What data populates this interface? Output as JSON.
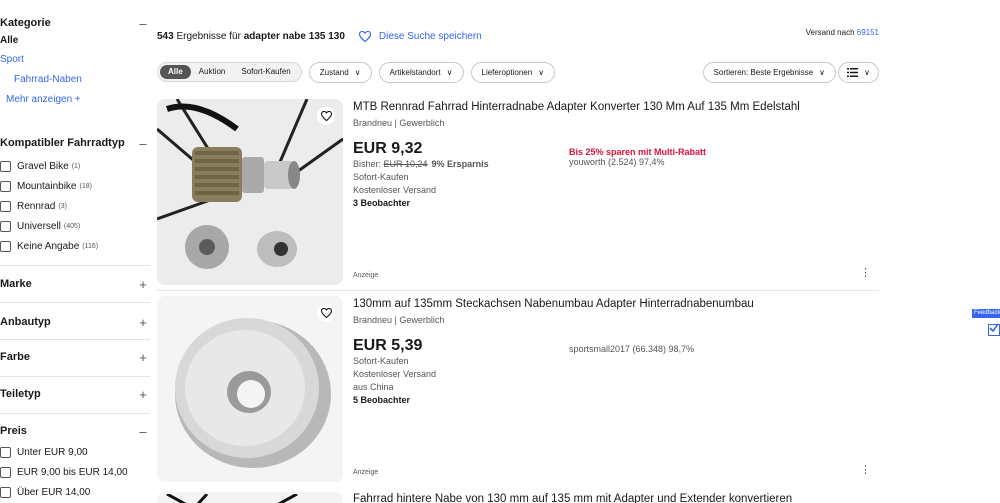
{
  "sidebar": {
    "kategorie": {
      "heading": "Kategorie",
      "toggle": "–",
      "alle": "Alle",
      "sport": "Sport",
      "fahrrad_naben": "Fahrrad-Naben",
      "mehr": "Mehr anzeigen +"
    },
    "fahrradtyp": {
      "heading": "Kompatibler Fahrradtyp",
      "toggle": "–",
      "options": [
        {
          "label": "Gravel Bike",
          "count": "(1)"
        },
        {
          "label": "Mountainbike",
          "count": "(18)"
        },
        {
          "label": "Rennrad",
          "count": "(3)"
        },
        {
          "label": "Universell",
          "count": "(405)"
        },
        {
          "label": "Keine Angabe",
          "count": "(116)"
        }
      ]
    },
    "collapsed": [
      {
        "heading": "Marke",
        "toggle": "+"
      },
      {
        "heading": "Anbautyp",
        "toggle": "+"
      },
      {
        "heading": "Farbe",
        "toggle": "+"
      },
      {
        "heading": "Teiletyp",
        "toggle": "+"
      }
    ],
    "preis": {
      "heading": "Preis",
      "toggle": "–",
      "options": [
        "Unter EUR 9,00",
        "EUR 9,00 bis EUR 14,00",
        "Über EUR 14,00"
      ]
    }
  },
  "results": {
    "count": "543",
    "text_mid": " Ergebnisse für ",
    "query": "adapter nabe 135 130",
    "save_search": "Diese Suche speichern",
    "ship_label": "Versand nach ",
    "ship_zip": "69151"
  },
  "filters": {
    "segments": [
      "Alle",
      "Auktion",
      "Sofort-Kaufen"
    ],
    "dropdowns": [
      "Zustand",
      "Artikelstandort",
      "Lieferoptionen"
    ],
    "sort": "Sortieren: Beste Ergebnisse",
    "chevron": "∨"
  },
  "items": [
    {
      "title": "MTB Rennrad Fahrrad Hinterradnabe Adapter Konverter 130 Mm Auf 135 Mm Edelstahl",
      "subtitle": "Brandneu | Gewerblich",
      "price": "EUR 9,32",
      "was_label": "Bisher: ",
      "was_price": "EUR 10,24",
      "save": "9% Ersparnis",
      "buy_type": "Sofort-Kaufen",
      "shipping": "Kostenloser Versand",
      "watchers": "3 Beobachter",
      "promo": "Bis 25% sparen mit Multi-Rabatt",
      "seller": "youworth (2.524) 97,4%",
      "ad_label": "Anzeige"
    },
    {
      "title": "130mm auf 135mm Steckachsen Nabenumbau Adapter Hinterradnabenumbau",
      "subtitle": "Brandneu | Gewerblich",
      "price": "EUR 5,39",
      "buy_type": "Sofort-Kaufen",
      "shipping": "Kostenloser Versand",
      "origin": "aus China",
      "watchers": "5 Beobachter",
      "seller": "sportsmall2017 (66.348) 98,7%",
      "ad_label": "Anzeige"
    },
    {
      "title": "Fahrrad hintere Nabe von 130 mm auf 135 mm mit Adapter und Extender konvertieren"
    }
  ],
  "feedback": {
    "label": "Feedback"
  },
  "colors": {
    "link": "#3665f3",
    "promo": "#e0103a",
    "text": "#191919"
  }
}
